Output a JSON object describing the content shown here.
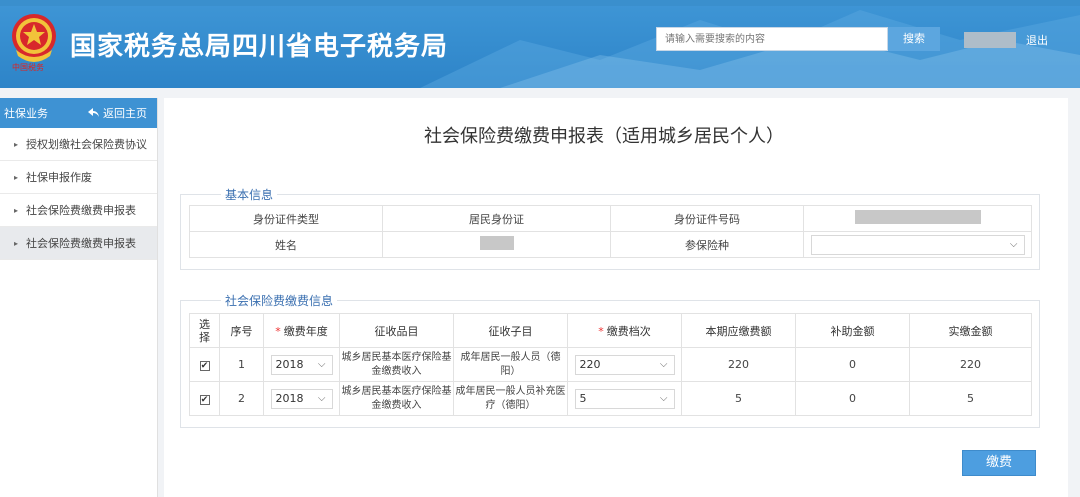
{
  "header": {
    "title": "国家税务总局四川省电子税务局",
    "emblem_caption": "中国税务",
    "search_placeholder": "请输入需要搜索的内容",
    "search_label": "搜索",
    "logout_label": "退出"
  },
  "sidebar": {
    "section_label": "社保业务",
    "back_label": "返回主页",
    "items": [
      {
        "label": "授权划缴社会保险费协议"
      },
      {
        "label": "社保申报作废"
      },
      {
        "label": "社会保险费缴费申报表"
      },
      {
        "label": "社会保险费缴费申报表"
      }
    ]
  },
  "main": {
    "title": "社会保险费缴费申报表（适用城乡居民个人）",
    "basic_info": {
      "legend": "基本信息",
      "id_type_label": "身份证件类型",
      "id_type_value": "居民身份证",
      "id_number_label": "身份证件号码",
      "name_label": "姓名",
      "insurance_type_label": "参保险种",
      "insurance_type_value": ""
    },
    "fee_info": {
      "legend": "社会保险费缴费信息",
      "headers": {
        "select": "选择",
        "index": "序号",
        "year": "缴费年度",
        "item": "征收品目",
        "subitem": "征收子目",
        "grade": "缴费档次",
        "payable": "本期应缴费额",
        "subsidy": "补助金额",
        "actual": "实缴金额"
      },
      "rows": [
        {
          "checked": "✔",
          "index": "1",
          "year": "2018",
          "item": "城乡居民基本医疗保险基金缴费收入",
          "subitem": "成年居民一般人员（德阳）",
          "grade": "220",
          "payable": "220",
          "subsidy": "0",
          "actual": "220"
        },
        {
          "checked": "✔",
          "index": "2",
          "year": "2018",
          "item": "城乡居民基本医疗保险基金缴费收入",
          "subitem": "成年居民一般人员补充医疗（德阳）",
          "grade": "5",
          "payable": "5",
          "subsidy": "0",
          "actual": "5"
        }
      ]
    },
    "pay_label": "缴费"
  },
  "colors": {
    "header_blue": "#2d84c8",
    "accent": "#4d9ee0",
    "sidebar_head": "#3e92d3"
  }
}
